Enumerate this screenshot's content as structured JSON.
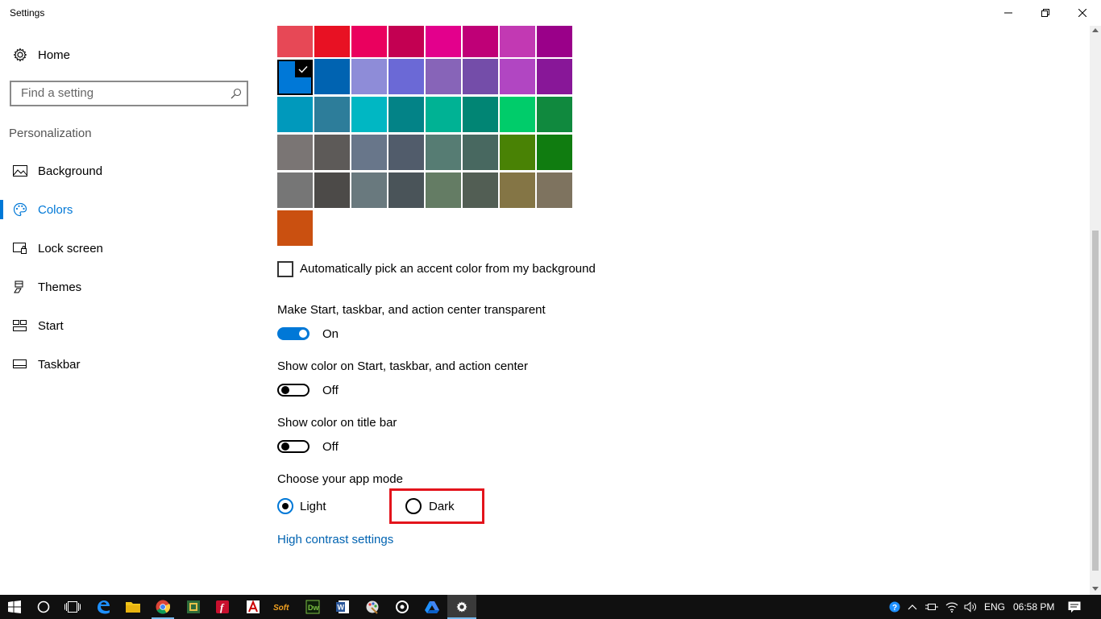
{
  "window": {
    "title": "Settings"
  },
  "sidebar": {
    "home_label": "Home",
    "search_placeholder": "Find a setting",
    "section": "Personalization",
    "items": [
      {
        "label": "Background",
        "icon": "picture-icon",
        "active": false
      },
      {
        "label": "Colors",
        "icon": "palette-icon",
        "active": true
      },
      {
        "label": "Lock screen",
        "icon": "lock-screen-icon",
        "active": false
      },
      {
        "label": "Themes",
        "icon": "themes-icon",
        "active": false
      },
      {
        "label": "Start",
        "icon": "start-icon",
        "active": false
      },
      {
        "label": "Taskbar",
        "icon": "taskbar-icon",
        "active": false
      }
    ]
  },
  "colors": {
    "accent": "#0078d7",
    "swatches": [
      [
        "#e74856",
        "#e81123",
        "#ea005e",
        "#c30052",
        "#e3008c",
        "#bf0077",
        "#c239b3",
        "#9a0089"
      ],
      [
        "#0078d7",
        "#0063b1",
        "#8e8cd8",
        "#6b69d6",
        "#8764b8",
        "#744da9",
        "#b146c2",
        "#881798"
      ],
      [
        "#0099bc",
        "#2d7d9a",
        "#00b7c3",
        "#038387",
        "#00b294",
        "#018574",
        "#00cc6a",
        "#10893e"
      ],
      [
        "#7a7574",
        "#5d5a58",
        "#68768a",
        "#515c6b",
        "#567c73",
        "#486860",
        "#498205",
        "#107c10"
      ],
      [
        "#767676",
        "#4c4a48",
        "#69797e",
        "#4a5459",
        "#647c64",
        "#525e54",
        "#847545",
        "#7e735f"
      ],
      [
        "#ca5010"
      ]
    ],
    "selected_swatch": "#0078d7"
  },
  "settings": {
    "auto_pick_label": "Automatically pick an accent color from my background",
    "auto_pick_checked": false,
    "transparent": {
      "label": "Make Start, taskbar, and action center transparent",
      "state": "On",
      "on": true
    },
    "show_color_start": {
      "label": "Show color on Start, taskbar, and action center",
      "state": "Off",
      "on": false
    },
    "show_color_title": {
      "label": "Show color on title bar",
      "state": "Off",
      "on": false
    },
    "app_mode": {
      "label": "Choose your app mode",
      "options": [
        "Light",
        "Dark"
      ],
      "selected": "Light"
    },
    "high_contrast_link": "High contrast settings"
  },
  "taskbar": {
    "apps": [
      "start-icon",
      "cortana-icon",
      "task-view-icon",
      "edge-icon",
      "file-explorer-icon",
      "chrome-icon",
      "app-icon",
      "flashget-icon",
      "acrobat-icon",
      "soft-icon",
      "dreamweaver-icon",
      "word-icon",
      "paint-icon",
      "media-icon",
      "drive-icon",
      "settings-icon"
    ],
    "language": "ENG",
    "time": "06:58 PM"
  }
}
